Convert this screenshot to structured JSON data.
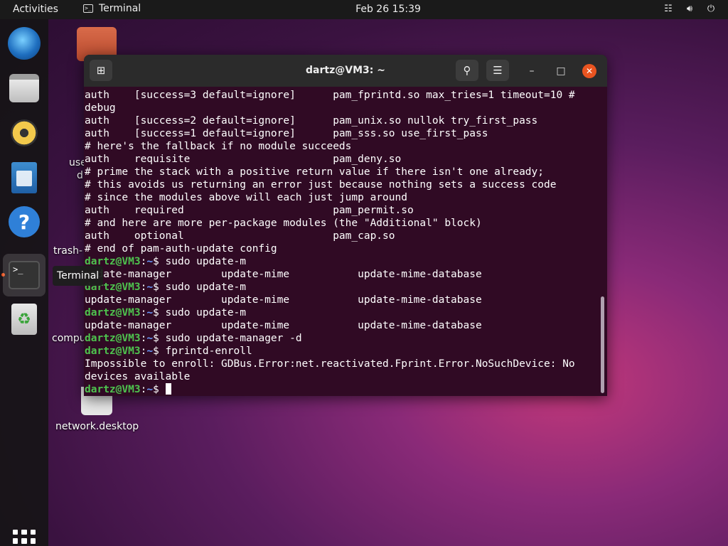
{
  "topbar": {
    "activities": "Activities",
    "app_name": "Terminal",
    "clock": "Feb 26  15:39"
  },
  "dock": {
    "items": [
      "thunderbird",
      "files",
      "rhythmbox",
      "libreoffice-writer",
      "help",
      "terminal",
      "trash"
    ],
    "tooltip": "Terminal"
  },
  "desktop": {
    "labels": {
      "use": "use",
      "d": "d",
      "trash": "trash-",
      "compu": "compu",
      "network": "network.desktop"
    }
  },
  "window": {
    "title": "dartz@VM3: ~"
  },
  "terminal": {
    "prompt_user": "dartz@VM3",
    "prompt_path": "~",
    "lines": [
      {
        "text": "auth    [success=3 default=ignore]      pam_fprintd.so max_tries=1 timeout=10 #"
      },
      {
        "text": "debug"
      },
      {
        "text": "auth    [success=2 default=ignore]      pam_unix.so nullok try_first_pass"
      },
      {
        "text": "auth    [success=1 default=ignore]      pam_sss.so use_first_pass"
      },
      {
        "text": "# here's the fallback if no module succeeds"
      },
      {
        "text": "auth    requisite                       pam_deny.so"
      },
      {
        "text": "# prime the stack with a positive return value if there isn't one already;"
      },
      {
        "text": "# this avoids us returning an error just because nothing sets a success code"
      },
      {
        "text": "# since the modules above will each just jump around"
      },
      {
        "text": "auth    required                        pam_permit.so"
      },
      {
        "text": "# and here are more per-package modules (the \"Additional\" block)"
      },
      {
        "text": "auth    optional                        pam_cap.so"
      },
      {
        "text": "# end of pam-auth-update config"
      },
      {
        "prompt": true,
        "text": "sudo update-m"
      },
      {
        "text": "update-manager        update-mime           update-mime-database"
      },
      {
        "prompt": true,
        "text": "sudo update-m"
      },
      {
        "text": "update-manager        update-mime           update-mime-database"
      },
      {
        "prompt": true,
        "text": "sudo update-m"
      },
      {
        "text": "update-manager        update-mime           update-mime-database"
      },
      {
        "prompt": true,
        "text": "sudo update-manager -d"
      },
      {
        "prompt": true,
        "text": "fprintd-enroll"
      },
      {
        "text": "Impossible to enroll: GDBus.Error:net.reactivated.Fprint.Error.NoSuchDevice: No"
      },
      {
        "text": "devices available"
      },
      {
        "prompt": true,
        "text": "",
        "cursor": true
      }
    ]
  }
}
